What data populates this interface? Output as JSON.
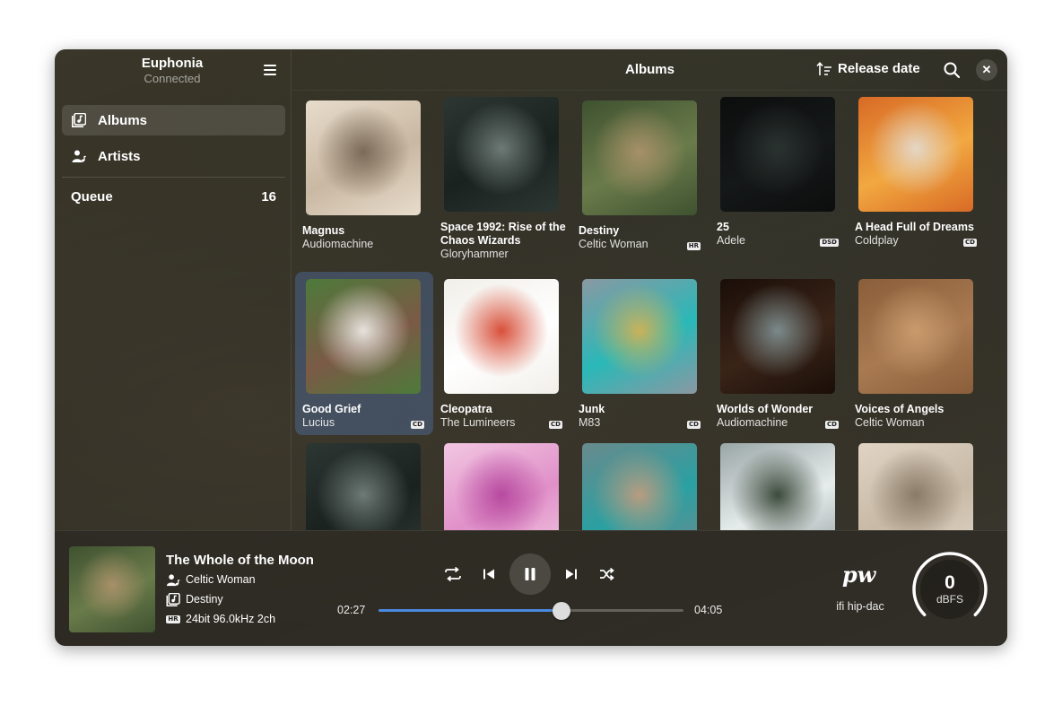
{
  "sidebar": {
    "app_title": "Euphonia",
    "app_status": "Connected",
    "items": [
      {
        "label": "Albums",
        "icon": "albums-icon"
      },
      {
        "label": "Artists",
        "icon": "artists-icon"
      }
    ],
    "queue_label": "Queue",
    "queue_count": "16"
  },
  "header": {
    "title": "Albums",
    "sort_label": "Release date"
  },
  "albums": [
    {
      "title": "Magnus",
      "artist": "Audiomachine",
      "badge": "",
      "colors": [
        "#c9b8a2",
        "#7a6a58",
        "#e8dccc"
      ]
    },
    {
      "title": "Space 1992: Rise of the Chaos Wizards",
      "artist": "Gloryhammer",
      "badge": "",
      "colors": [
        "#1a2220",
        "#6d7a76",
        "#2c3632"
      ]
    },
    {
      "title": "Destiny",
      "artist": "Celtic Woman",
      "badge": "HR",
      "colors": [
        "#6a7b4a",
        "#a79068",
        "#3f5230"
      ]
    },
    {
      "title": "25",
      "artist": "Adele",
      "badge": "DSD",
      "colors": [
        "#151818",
        "#2a3230",
        "#0c0e0e"
      ]
    },
    {
      "title": "A Head Full of Dreams",
      "artist": "Coldplay",
      "badge": "CD",
      "colors": [
        "#f2a840",
        "#e4d6c6",
        "#d86a26"
      ]
    },
    {
      "title": "Good Grief",
      "artist": "Lucius",
      "badge": "CD",
      "colors": [
        "#7b5a46",
        "#e6e2dc",
        "#4d7a3a"
      ]
    },
    {
      "title": "Cleopatra",
      "artist": "The Lumineers",
      "badge": "CD",
      "colors": [
        "#ffffff",
        "#d8503a",
        "#f1efe9"
      ]
    },
    {
      "title": "Junk",
      "artist": "M83",
      "badge": "CD",
      "colors": [
        "#2ab8b8",
        "#c9b25a",
        "#8a98a2"
      ]
    },
    {
      "title": "Worlds of Wonder",
      "artist": "Audiomachine",
      "badge": "CD",
      "colors": [
        "#3a2418",
        "#7b8a8a",
        "#1a0e08"
      ]
    },
    {
      "title": "Voices of Angels",
      "artist": "Celtic Woman",
      "badge": "",
      "colors": [
        "#a97a52",
        "#c89a6c",
        "#8a5e3a"
      ]
    },
    {
      "title": "",
      "artist": "",
      "badge": "",
      "colors": [
        "#1a2220",
        "#6d7a76",
        "#2c3632"
      ]
    },
    {
      "title": "",
      "artist": "",
      "badge": "",
      "colors": [
        "#e090c8",
        "#b84aa0",
        "#f2c6e2"
      ]
    },
    {
      "title": "",
      "artist": "",
      "badge": "",
      "colors": [
        "#2aa0a2",
        "#b89c80",
        "#6a8a8c"
      ]
    },
    {
      "title": "",
      "artist": "",
      "badge": "",
      "colors": [
        "#e6ecec",
        "#3c4a3c",
        "#9aa6a6"
      ]
    },
    {
      "title": "",
      "artist": "",
      "badge": "",
      "colors": [
        "#c8b9a6",
        "#8a7a68",
        "#e0d4c4"
      ]
    }
  ],
  "selected_album_index": 5,
  "player": {
    "title": "The Whole of the Moon",
    "artist": "Celtic Woman",
    "album": "Destiny",
    "quality_badge": "HR",
    "format": "24bit 96.0kHz 2ch",
    "elapsed": "02:27",
    "duration": "04:05",
    "progress": 0.6,
    "output_logo": "pw",
    "output_name": "ifi hip-dac",
    "level_value": "0",
    "level_unit": "dBFS",
    "accent": "#4a8ae0"
  }
}
